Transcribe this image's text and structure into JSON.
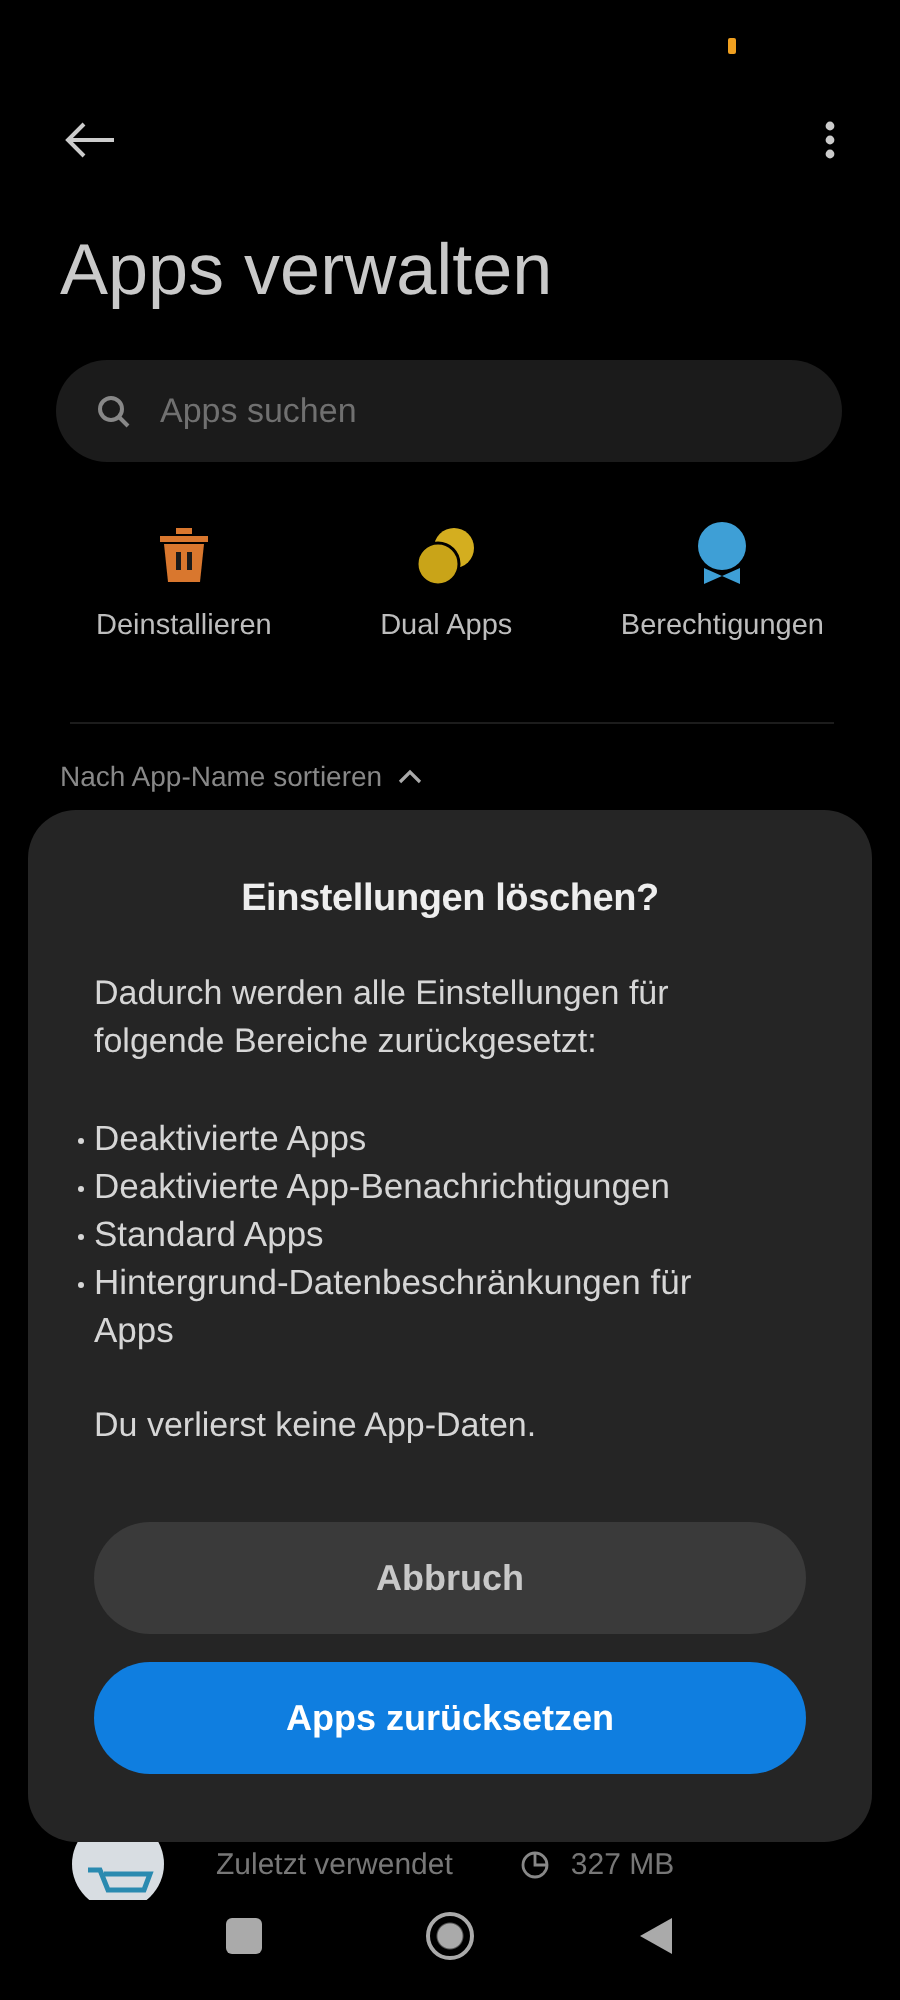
{
  "header": {
    "title": "Apps verwalten"
  },
  "search": {
    "placeholder": "Apps suchen"
  },
  "shortcuts": [
    {
      "kind": "trash",
      "label": "Deinstallieren"
    },
    {
      "kind": "dual",
      "label": "Dual Apps"
    },
    {
      "kind": "badge",
      "label": "Berechtigungen"
    }
  ],
  "sort": {
    "label": "Nach App-Name sortieren"
  },
  "app_row": {
    "subtitle": "Zuletzt verwendet",
    "size": "327 MB"
  },
  "dialog": {
    "title": "Einstellungen löschen?",
    "intro": "Dadurch werden alle Einstellungen für folgende Bereiche zurückgesetzt:",
    "items": [
      "Deaktivierte Apps",
      "Deaktivierte App-Benachrichtigungen",
      "Standard Apps",
      "Hintergrund-Datenbeschränkungen für Apps"
    ],
    "note": "Du verlierst keine App-Daten.",
    "buttons": [
      {
        "kind": "secondary",
        "label": "Abbruch"
      },
      {
        "kind": "primary",
        "label": "Apps zurücksetzen"
      }
    ]
  }
}
